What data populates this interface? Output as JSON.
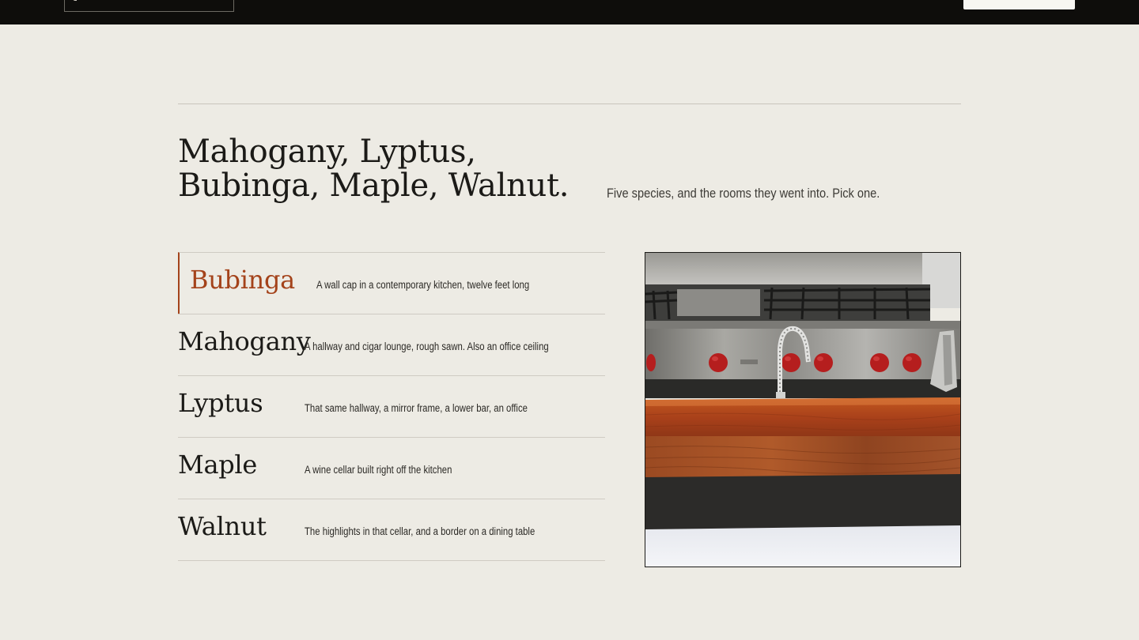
{
  "colors": {
    "page_background": "#edebe4",
    "topbar_background": "#0e0d0b",
    "accent": "#a4431b",
    "text": "#1b1a17"
  },
  "header": {
    "search_icon": "search-icon"
  },
  "main": {
    "headline": "Mahogany, Lyptus, Bubinga, Maple, Walnut.",
    "intro": "Five species, and the rooms they went into. Pick one."
  },
  "species": [
    {
      "name": "Bubinga",
      "description": "A wall cap in a contemporary kitchen, twelve feet long",
      "selected": true
    },
    {
      "name": "Mahogany",
      "description": "A hallway and cigar lounge, rough sawn. Also an office ceiling",
      "selected": false
    },
    {
      "name": "Lyptus",
      "description": "That same hallway, a mirror frame, a lower bar, an office",
      "selected": false
    },
    {
      "name": "Maple",
      "description": "A wine cellar built right off the kitchen",
      "selected": false
    },
    {
      "name": "Walnut",
      "description": "The highlights in that cellar, and a border on a dining table",
      "selected": false
    }
  ]
}
